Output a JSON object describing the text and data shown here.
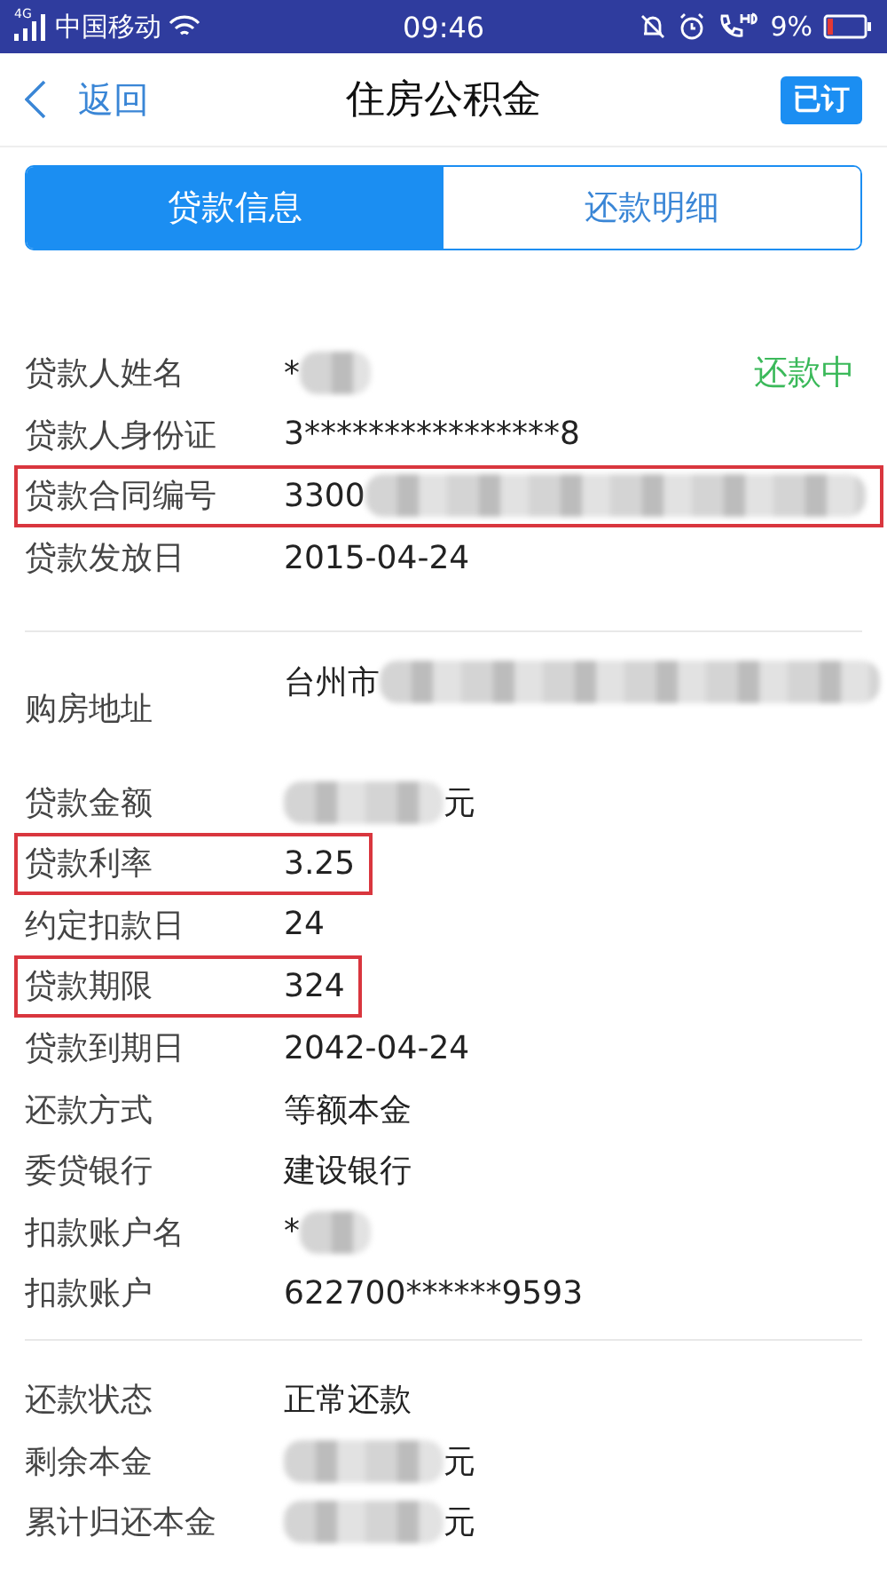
{
  "status_bar": {
    "network": "4G",
    "carrier": "中国移动",
    "time": "09:46",
    "battery": "9%"
  },
  "nav": {
    "back": "返回",
    "title": "住房公积金",
    "subscribe": "已订"
  },
  "tabs": [
    {
      "label": "贷款信息",
      "selected": true
    },
    {
      "label": "还款明细",
      "selected": false
    }
  ],
  "groups": [
    {
      "rows": [
        {
          "kind": "plain",
          "label": "贷款人姓名",
          "value": "*",
          "redacted": true,
          "highlighted": false,
          "status": "还款中"
        },
        {
          "kind": "plain",
          "label": "贷款人身份证",
          "value": "3****************8",
          "redacted": false,
          "highlighted": false
        },
        {
          "kind": "plain",
          "label": "贷款合同编号",
          "value": "3300",
          "redacted": true,
          "highlighted": true
        },
        {
          "kind": "plain",
          "label": "贷款发放日",
          "value": "2015-04-24",
          "redacted": false,
          "highlighted": false
        }
      ]
    },
    {
      "rows": [
        {
          "kind": "address",
          "label": "购房地址",
          "value": "台州市",
          "redacted": true,
          "highlighted": false
        },
        {
          "kind": "plain",
          "label": "贷款金额",
          "unit": "元",
          "redacted": true,
          "highlighted": false
        },
        {
          "kind": "plain",
          "label": "贷款利率",
          "value": "3.25",
          "redacted": false,
          "highlighted": true
        },
        {
          "kind": "plain",
          "label": "约定扣款日",
          "value": "24",
          "redacted": false,
          "highlighted": false
        },
        {
          "kind": "plain",
          "label": "贷款期限",
          "value": "324",
          "redacted": false,
          "highlighted": true
        },
        {
          "kind": "plain",
          "label": "贷款到期日",
          "value": "2042-04-24",
          "redacted": false,
          "highlighted": false
        },
        {
          "kind": "plain",
          "label": "还款方式",
          "value": "等额本金",
          "redacted": false,
          "highlighted": false
        },
        {
          "kind": "plain",
          "label": "委贷银行",
          "value": "建设银行",
          "redacted": false,
          "highlighted": false
        },
        {
          "kind": "plain",
          "label": "扣款账户名",
          "value": "*",
          "redacted": true,
          "highlighted": false
        },
        {
          "kind": "plain",
          "label": "扣款账户",
          "value": "622700******9593",
          "redacted": false,
          "highlighted": false
        }
      ]
    },
    {
      "rows": [
        {
          "kind": "plain",
          "label": "还款状态",
          "value": "正常还款",
          "redacted": false,
          "highlighted": false
        },
        {
          "kind": "plain",
          "label": "剩余本金",
          "unit": "元",
          "redacted": true,
          "highlighted": false
        },
        {
          "kind": "plain",
          "label": "累计归还本金",
          "unit": "元",
          "redacted": true,
          "highlighted": false
        }
      ]
    }
  ]
}
